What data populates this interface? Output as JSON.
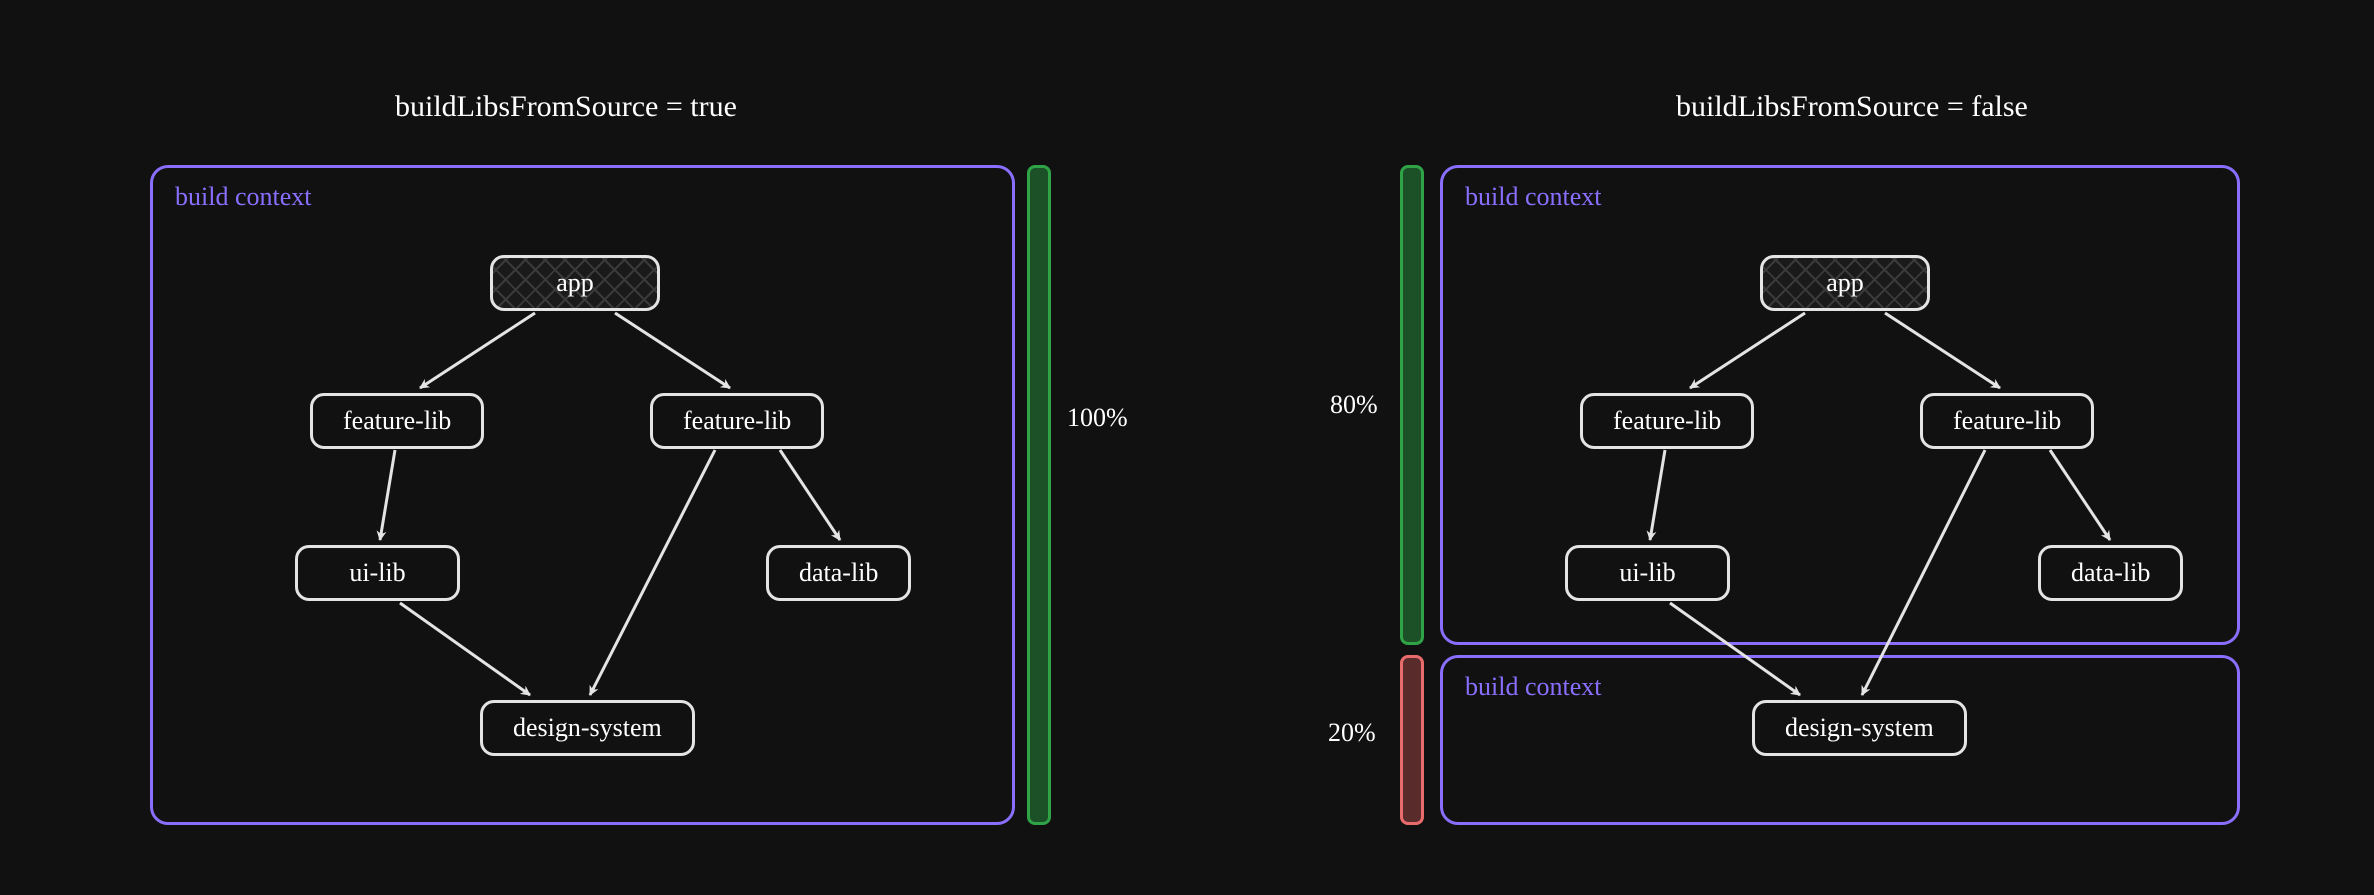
{
  "left": {
    "title": "buildLibsFromSource = true",
    "contextLabel": "build context",
    "nodes": {
      "app": "app",
      "feature1": "feature-lib",
      "feature2": "feature-lib",
      "uilib": "ui-lib",
      "datalib": "data-lib",
      "design": "design-system"
    },
    "barPercent": "100%"
  },
  "right": {
    "title": "buildLibsFromSource = false",
    "contextLabelTop": "build context",
    "contextLabelBottom": "build context",
    "nodes": {
      "app": "app",
      "feature1": "feature-lib",
      "feature2": "feature-lib",
      "uilib": "ui-lib",
      "datalib": "data-lib",
      "design": "design-system"
    },
    "topPercent": "80%",
    "bottomPercent": "20%"
  },
  "colors": {
    "purple": "#8a6fff",
    "green": "#2fa345",
    "red": "#e86c6c",
    "node": "#e4e4e4"
  }
}
